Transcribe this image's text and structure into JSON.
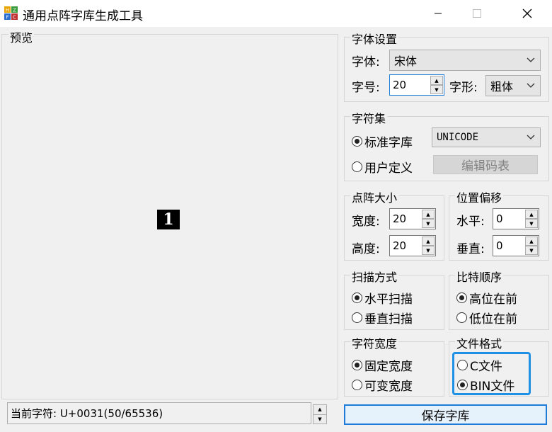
{
  "window": {
    "title": "通用点阵字库生成工具",
    "minimize_icon": "minimize-icon",
    "maximize_icon": "maximize-icon",
    "close_icon": "close-icon"
  },
  "preview": {
    "legend": "预览",
    "glyph": "1",
    "status_text": "当前字符: U+0031(50/65536)"
  },
  "font_settings": {
    "legend": "字体设置",
    "font_label": "字体:",
    "font_value": "宋体",
    "size_label": "字号:",
    "size_value": "20",
    "style_label": "字形:",
    "style_value": "粗体"
  },
  "charset": {
    "legend": "字符集",
    "standard_label": "标准字库",
    "standard_selected": true,
    "encoding_value": "UNICODE",
    "custom_label": "用户定义",
    "edit_button": "编辑码表"
  },
  "matrix_size": {
    "legend": "点阵大小",
    "width_label": "宽度:",
    "width_value": "20",
    "height_label": "高度:",
    "height_value": "20"
  },
  "offset": {
    "legend": "位置偏移",
    "h_label": "水平:",
    "h_value": "0",
    "v_label": "垂直:",
    "v_value": "0"
  },
  "scan_mode": {
    "legend": "扫描方式",
    "horizontal": "水平扫描",
    "vertical": "垂直扫描",
    "selected": "horizontal"
  },
  "bit_order": {
    "legend": "比特顺序",
    "msb_first": "高位在前",
    "lsb_first": "低位在前",
    "selected": "msb_first"
  },
  "char_width": {
    "legend": "字符宽度",
    "fixed": "固定宽度",
    "variable": "可变宽度",
    "selected": "fixed"
  },
  "file_format": {
    "legend": "文件格式",
    "c_file": "C文件",
    "bin_file": "BIN文件",
    "selected": "bin",
    "focus_color": "#1e90e6"
  },
  "save_button": "保存字库"
}
